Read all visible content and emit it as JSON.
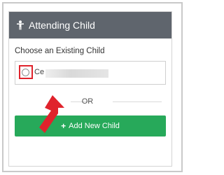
{
  "panel": {
    "title": "Attending Child",
    "header_icon": "child-icon"
  },
  "existing": {
    "label": "Choose an Existing Child",
    "child_name_visible": "Ce",
    "selected": false
  },
  "divider": {
    "text": "OR"
  },
  "add_button": {
    "label": "Add New Child",
    "icon": "plus-icon"
  },
  "annotation": {
    "color": "#e0232c",
    "type": "arrow-with-box"
  },
  "colors": {
    "header_bg": "#5f656d",
    "button_bg": "#27a95a"
  }
}
